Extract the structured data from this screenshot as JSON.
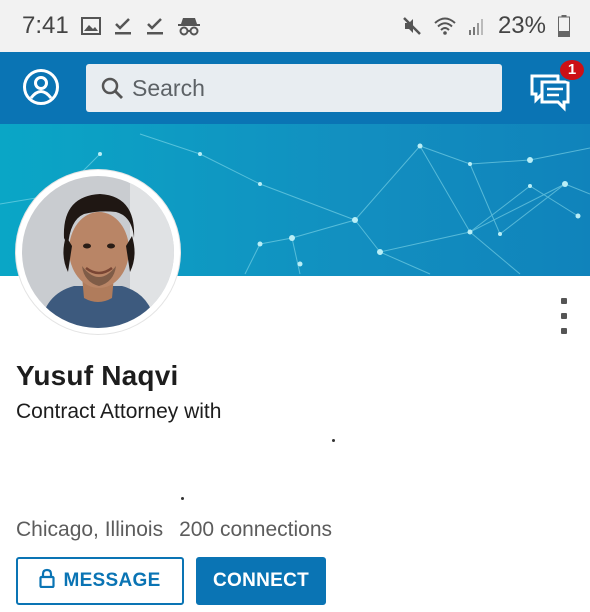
{
  "status_bar": {
    "time": "7:41",
    "battery": "23%",
    "left_icons": [
      "image-icon",
      "check-download-icon",
      "check-download-icon",
      "incognito-icon"
    ],
    "right_icons": [
      "mute-icon",
      "wifi-icon",
      "signal-icon",
      "battery-icon"
    ]
  },
  "header": {
    "search_placeholder": "Search",
    "messages_badge": "1",
    "accent": "#0a74b4"
  },
  "profile": {
    "name": "Yusuf Naqvi",
    "headline": "Contract Attorney with",
    "location": "Chicago, Illinois",
    "connections": "200 connections"
  },
  "actions": {
    "message_label": "MESSAGE",
    "connect_label": "CONNECT"
  }
}
